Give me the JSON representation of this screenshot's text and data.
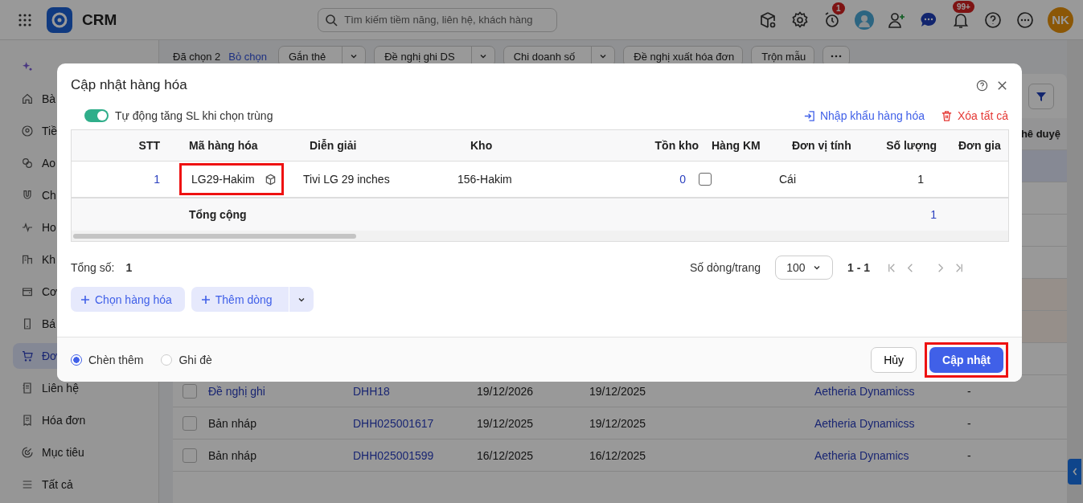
{
  "topbar": {
    "app_name": "CRM",
    "search": {
      "placeholder": "Tìm kiếm tiềm năng, liên hệ, khách hàng"
    },
    "alarm_badge": "1",
    "notification_badge": "99+",
    "avatar": "NK"
  },
  "sidebar": {
    "items": [
      {
        "label": "Bà",
        "selected": false
      },
      {
        "label": "Tiề",
        "selected": false
      },
      {
        "label": "Ao",
        "selected": false
      },
      {
        "label": "Ch",
        "selected": false
      },
      {
        "label": "Ho",
        "selected": false
      },
      {
        "label": "Kh",
        "selected": false
      },
      {
        "label": "Cơ",
        "selected": false
      },
      {
        "label": "Bá",
        "selected": false
      },
      {
        "label": "Đơ",
        "selected": true
      },
      {
        "label": "Liên hệ",
        "selected": false
      },
      {
        "label": "Hóa đơn",
        "selected": false
      },
      {
        "label": "Mục tiêu",
        "selected": false
      },
      {
        "label": "Tất cả",
        "selected": false
      }
    ]
  },
  "toolbar": {
    "selected_count": "Đã chọn 2",
    "clear": "Bỏ chọn",
    "actions": [
      {
        "label": "Gắn thẻ",
        "has_menu": true
      },
      {
        "label": "Đề nghị ghi DS",
        "has_menu": true
      },
      {
        "label": "Chi doanh số",
        "has_menu": true
      },
      {
        "label": "Đề nghị xuất hóa đơn",
        "has_menu": false
      },
      {
        "label": "Trộn mẫu",
        "has_menu": false
      }
    ]
  },
  "orders": {
    "last_column": "hê duyệ",
    "covered_rows": [
      {
        "selected": true,
        "warning": false
      },
      {
        "selected": false,
        "warning": false
      },
      {
        "selected": false,
        "warning": false
      },
      {
        "selected": false,
        "warning": false
      },
      {
        "selected": false,
        "warning": true
      },
      {
        "selected": false,
        "warning": true
      },
      {
        "selected": false,
        "warning": false
      }
    ],
    "rows": [
      {
        "checked": false,
        "status": "Đề nghị ghi",
        "status_link": true,
        "code": "DHH18",
        "date_1": "19/12/2026",
        "date_2": "19/12/2025",
        "customer": "Aetheria Dynamicss",
        "column_6": "-"
      },
      {
        "checked": false,
        "status": "Bản nháp",
        "status_link": false,
        "code": "DHH025001617",
        "date_1": "19/12/2025",
        "date_2": "19/12/2025",
        "customer": "Aetheria Dynamicss",
        "column_6": "-"
      },
      {
        "checked": false,
        "status": "Bản nháp",
        "status_link": false,
        "code": "DHH025001599",
        "date_1": "16/12/2025",
        "date_2": "16/12/2025",
        "customer": "Aetheria Dynamics",
        "column_6": "-"
      }
    ]
  },
  "dialog": {
    "title": "Cập nhật hàng hóa",
    "auto_increase": {
      "label": "Tự động tăng SL khi chọn trùng",
      "on": true
    },
    "import_link": "Nhập khẩu hàng hóa",
    "clear_all": "Xóa tất cả",
    "table": {
      "columns": [
        "STT",
        "Mã hàng hóa",
        "Diễn giải",
        "Kho",
        "Tồn kho",
        "Hàng KM",
        "Đơn vị tính",
        "Số lượng",
        "Đơn gia"
      ],
      "rows": [
        {
          "stt": "1",
          "code": "LG29-Hakim",
          "code_highlighted": true,
          "description": "Tivi LG 29 inches",
          "warehouse": "156-Hakim",
          "stock": "0",
          "promo": false,
          "unit": "Cái",
          "quantity": "1"
        }
      ],
      "total": {
        "label": "Tổng cộng",
        "quantity": "1"
      }
    },
    "total_count": {
      "label": "Tổng số:",
      "value": "1"
    },
    "pager": {
      "label": "Số dòng/trang",
      "page_size": "100",
      "range": "1 - 1"
    },
    "buttons": {
      "choose": "Chọn hàng hóa",
      "add_row": "Thêm dòng"
    },
    "modes": [
      {
        "label": "Chèn thêm",
        "selected": true
      },
      {
        "label": "Ghi đè",
        "selected": false
      }
    ],
    "cancel": "Hủy",
    "submit": {
      "label": "Cập nhật",
      "highlighted": true
    }
  }
}
